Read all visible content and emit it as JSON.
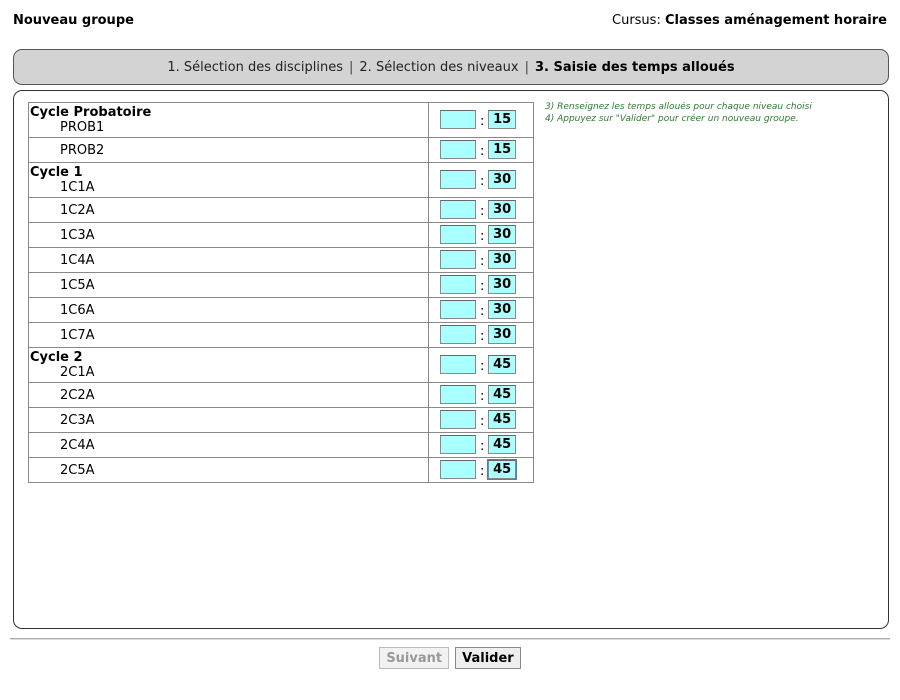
{
  "header": {
    "title": "Nouveau groupe",
    "cursus_label": "Cursus:",
    "cursus_value": "Classes aménagement horaire"
  },
  "steps": {
    "step1": "1. Sélection des disciplines",
    "step2": "2. Sélection des niveaux",
    "step3": "3. Saisie des temps alloués",
    "separator": "|"
  },
  "help": {
    "line1": "3) Renseignez les temps alloués pour chaque niveau choisi",
    "line2": "4) Appuyez sur \"Valider\" pour créer un nouveau groupe."
  },
  "groups": [
    {
      "label": "Cycle Probatoire",
      "levels": [
        {
          "name": "PROB1",
          "hours": "",
          "minutes": "15"
        },
        {
          "name": "PROB2",
          "hours": "",
          "minutes": "15"
        }
      ]
    },
    {
      "label": "Cycle 1",
      "levels": [
        {
          "name": "1C1A",
          "hours": "",
          "minutes": "30"
        },
        {
          "name": "1C2A",
          "hours": "",
          "minutes": "30"
        },
        {
          "name": "1C3A",
          "hours": "",
          "minutes": "30"
        },
        {
          "name": "1C4A",
          "hours": "",
          "minutes": "30"
        },
        {
          "name": "1C5A",
          "hours": "",
          "minutes": "30"
        },
        {
          "name": "1C6A",
          "hours": "",
          "minutes": "30"
        },
        {
          "name": "1C7A",
          "hours": "",
          "minutes": "30"
        }
      ]
    },
    {
      "label": "Cycle 2",
      "levels": [
        {
          "name": "2C1A",
          "hours": "",
          "minutes": "45"
        },
        {
          "name": "2C2A",
          "hours": "",
          "minutes": "45"
        },
        {
          "name": "2C3A",
          "hours": "",
          "minutes": "45"
        },
        {
          "name": "2C4A",
          "hours": "",
          "minutes": "45"
        },
        {
          "name": "2C5A",
          "hours": "",
          "minutes": "45"
        }
      ]
    }
  ],
  "time_separator": ":",
  "buttons": {
    "next": "Suivant",
    "validate": "Valider"
  }
}
